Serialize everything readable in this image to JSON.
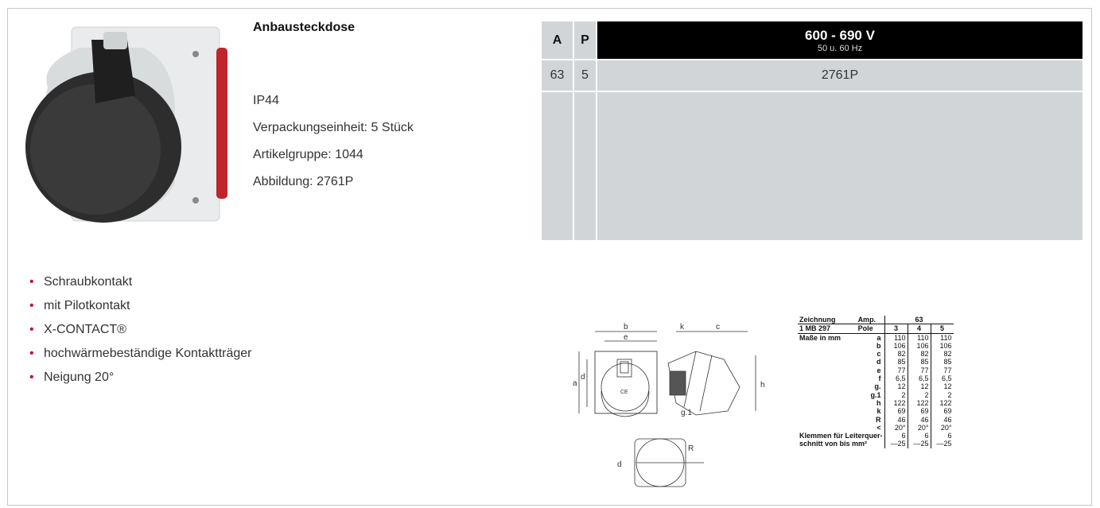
{
  "product": {
    "title": "Anbausteckdose",
    "attributes": [
      "IP44",
      "Verpackungseinheit: 5 Stück",
      "Artikelgruppe: 1044",
      "Abbildung: 2761P"
    ]
  },
  "spec_table": {
    "col_a": "A",
    "col_p": "P",
    "voltage": "600 - 690 V",
    "frequency": "50 u. 60 Hz",
    "rows": [
      {
        "a": "63",
        "p": "5",
        "article": "2761P"
      }
    ]
  },
  "features": [
    "Schraubkontakt",
    "mit Pilotkontakt",
    "X-CONTACT®",
    "hochwärmebeständige Kontaktträger",
    "Neigung 20°"
  ],
  "bullet": "•",
  "dimensions": {
    "head1": [
      "Zeichnung",
      "Amp.",
      "63"
    ],
    "head2": [
      "1 MB 297",
      "Pole",
      "3",
      "4",
      "5"
    ],
    "section": "Maße in mm",
    "rows": [
      {
        "k": "a",
        "v": [
          "110",
          "110",
          "110"
        ]
      },
      {
        "k": "b",
        "v": [
          "106",
          "106",
          "106"
        ]
      },
      {
        "k": "c",
        "v": [
          "82",
          "82",
          "82"
        ]
      },
      {
        "k": "d",
        "v": [
          "85",
          "85",
          "85"
        ]
      },
      {
        "k": "e",
        "v": [
          "77",
          "77",
          "77"
        ]
      },
      {
        "k": "f",
        "v": [
          "6,5",
          "6,5",
          "6,5"
        ]
      },
      {
        "k": "g.",
        "v": [
          "12",
          "12",
          "12"
        ]
      },
      {
        "k": "g.1",
        "v": [
          "2",
          "2",
          "2"
        ]
      },
      {
        "k": "h",
        "v": [
          "122",
          "122",
          "122"
        ]
      },
      {
        "k": "k",
        "v": [
          "69",
          "69",
          "69"
        ]
      },
      {
        "k": "R",
        "v": [
          "46",
          "46",
          "46"
        ]
      },
      {
        "k": "<",
        "v": [
          "20°",
          "20°",
          "20°"
        ]
      }
    ],
    "footer1": [
      "Klemmen für Leiterquer-",
      "6",
      "6",
      "6"
    ],
    "footer2": [
      "schnitt von bis mm²",
      "—25",
      "—25",
      "—25"
    ]
  },
  "drawing_labels": {
    "b": "b",
    "e": "e",
    "k": "k",
    "c": "c",
    "a": "a",
    "d": "d",
    "h": "h",
    "g1": "g.1",
    "R": "R",
    "ce": "CE"
  }
}
